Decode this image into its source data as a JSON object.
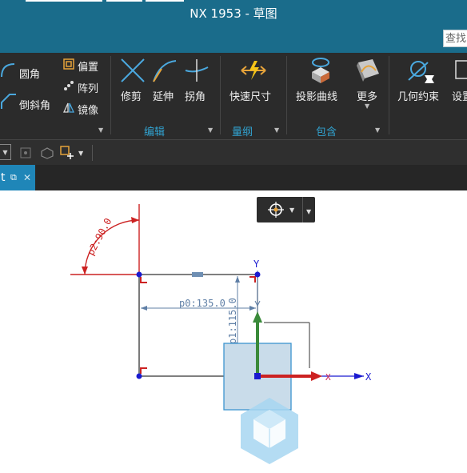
{
  "window": {
    "title": "NX 1953 - 草图",
    "search_placeholder": "查找"
  },
  "ribbon": {
    "fillet": "圆角",
    "chamfer": "倒斜角",
    "offset": "偏置",
    "pattern": "阵列",
    "mirror": "镜像",
    "trim": "修剪",
    "extend": "延伸",
    "corner": "拐角",
    "rapid_dimension": "快速尺寸",
    "project_curve": "投影曲线",
    "more": "更多",
    "geometric_constraints": "几何约束",
    "settings": "设置",
    "groups": {
      "edit": "编辑",
      "dimension": "量纲",
      "include": "包含"
    }
  },
  "tab": {
    "label": "t"
  },
  "sketch": {
    "angle_dim": "p2:90.0",
    "horizontal_dim": "p0:135.0",
    "vertical_dim": "p1:115.0",
    "axis_x": "X",
    "axis_y": "Y",
    "axis_x_small": "X"
  },
  "colors": {
    "accent": "#1a6c8b",
    "ribbon": "#2b2b2b",
    "group_label": "#31a3d1",
    "dimension": "#cc2222",
    "geometry": "#333333",
    "point": "#1a1ad0"
  }
}
